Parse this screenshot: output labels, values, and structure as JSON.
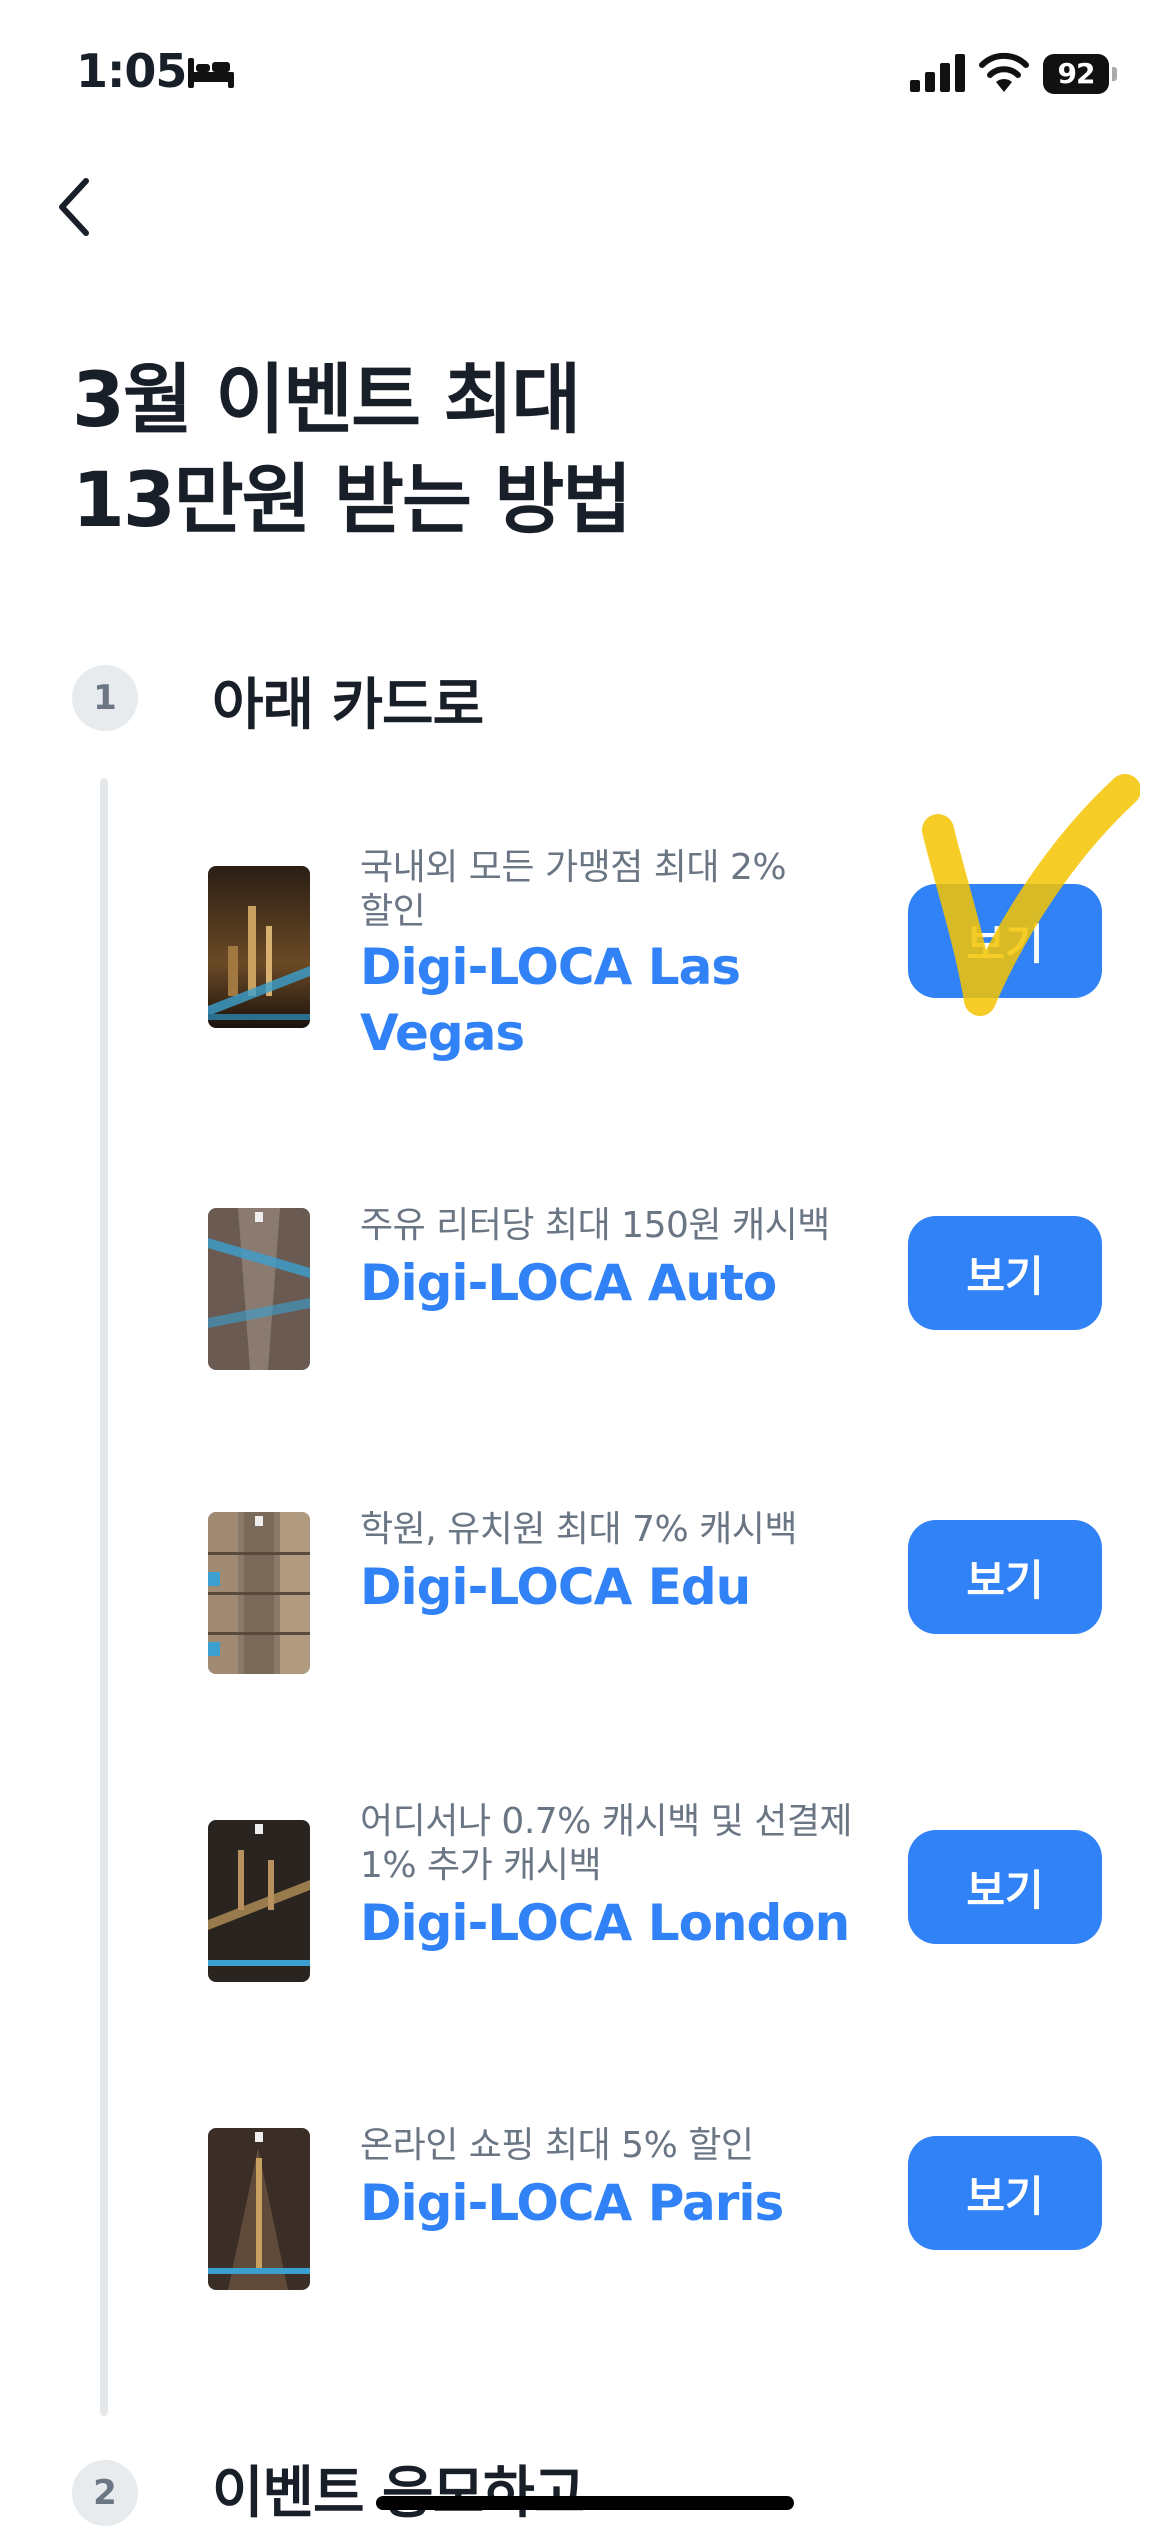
{
  "status_bar": {
    "time": "1:05",
    "battery": "92",
    "icons": [
      "bed-icon",
      "cellular-signal-icon",
      "wifi-icon",
      "battery-icon"
    ]
  },
  "nav": {
    "back_icon": "chevron-left-icon"
  },
  "title": {
    "line1": "3월 이벤트 최대",
    "line2": "13만원 받는 방법"
  },
  "steps": [
    {
      "number": "1",
      "title": "아래 카드로"
    },
    {
      "number": "2",
      "title": "이벤트 응모하고"
    }
  ],
  "cards": [
    {
      "desc_line1": "국내외 모든 가맹점 최대 2%",
      "desc_line2": "할인",
      "name_line1": "Digi-LOCA Las",
      "name_line2": "Vegas",
      "button": "보기"
    },
    {
      "desc_line1": "주유 리터당 최대 150원 캐시백",
      "desc_line2": "",
      "name_line1": "Digi-LOCA Auto",
      "name_line2": "",
      "button": "보기"
    },
    {
      "desc_line1": "학원, 유치원 최대 7% 캐시백",
      "desc_line2": "",
      "name_line1": "Digi-LOCA Edu",
      "name_line2": "",
      "button": "보기"
    },
    {
      "desc_line1": "어디서나 0.7% 캐시백 및 선결제",
      "desc_line2": "1% 추가 캐시백",
      "name_line1": "Digi-LOCA London",
      "name_line2": "",
      "button": "보기"
    },
    {
      "desc_line1": "온라인 쇼핑 최대 5% 할인",
      "desc_line2": "",
      "name_line1": "Digi-LOCA Paris",
      "name_line2": "",
      "button": "보기"
    }
  ],
  "colors": {
    "accent": "#3182f6",
    "text_primary": "#191f28",
    "text_secondary": "#6b7684",
    "annotation_yellow": "#f5c400"
  }
}
